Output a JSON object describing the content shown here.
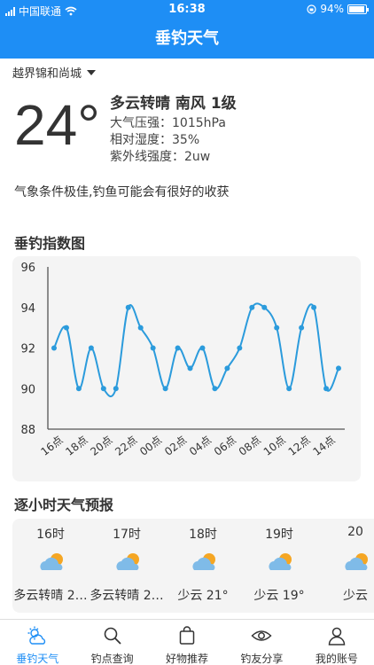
{
  "status_bar": {
    "carrier": "中国联通",
    "time": "16:38",
    "battery": "94%",
    "battery_level": 0.94
  },
  "nav": {
    "title": "垂钓天气"
  },
  "location": {
    "name": "越界锦和尚城"
  },
  "current": {
    "temperature": "24°",
    "condition": "多云转晴 南风 1级",
    "pressure": "大气压强：1015hPa",
    "humidity": "相对湿度：35%",
    "uv": "紫外线强度：2uw",
    "tip": "气象条件极佳,钓鱼可能会有很好的收获"
  },
  "index_section": {
    "title": "垂钓指数图"
  },
  "chart_data": {
    "type": "line",
    "title": "",
    "ylim": [
      88,
      96
    ],
    "y_ticks": [
      "88",
      "90",
      "92",
      "94",
      "96"
    ],
    "x_tick_labels": [
      "16点",
      "18点",
      "20点",
      "22点",
      "00点",
      "02点",
      "04点",
      "06点",
      "08点",
      "10点",
      "12点",
      "14点"
    ],
    "x": [
      "16",
      "17",
      "18",
      "19",
      "20",
      "21",
      "22",
      "23",
      "00",
      "01",
      "02",
      "03",
      "04",
      "05",
      "06",
      "07",
      "08",
      "09",
      "10",
      "11",
      "12",
      "13",
      "14",
      "15"
    ],
    "series": [
      {
        "values": [
          92,
          93,
          90,
          92,
          90,
          90,
          94,
          93,
          92,
          90,
          92,
          91,
          92,
          90,
          91,
          92,
          94,
          94,
          93,
          90,
          93,
          94,
          90,
          91
        ]
      }
    ],
    "color": "#2b9bdc",
    "grid": false
  },
  "hourly_section": {
    "title": "逐小时天气预报"
  },
  "hourly": [
    {
      "time": "16时",
      "desc": "多云转晴 2…",
      "icon": "partly-cloudy-icon"
    },
    {
      "time": "17时",
      "desc": "多云转晴 2…",
      "icon": "partly-cloudy-icon"
    },
    {
      "time": "18时",
      "desc": "少云 21°",
      "icon": "partly-cloudy-icon"
    },
    {
      "time": "19时",
      "desc": "少云 19°",
      "icon": "partly-cloudy-icon"
    },
    {
      "time": "20",
      "desc": "少云",
      "icon": "partly-cloudy-icon"
    }
  ],
  "tabs": [
    {
      "label": "垂钓天气",
      "icon": "weather-icon",
      "active": true
    },
    {
      "label": "钓点查询",
      "icon": "search-icon",
      "active": false
    },
    {
      "label": "好物推荐",
      "icon": "shopping-bag-icon",
      "active": false
    },
    {
      "label": "钓友分享",
      "icon": "eye-icon",
      "active": false
    },
    {
      "label": "我的账号",
      "icon": "user-icon",
      "active": false
    }
  ],
  "colors": {
    "primary": "#1e8ef5",
    "chart_line": "#2b9bdc",
    "sun": "#f5a623",
    "cloud": "#7fbbe8"
  }
}
